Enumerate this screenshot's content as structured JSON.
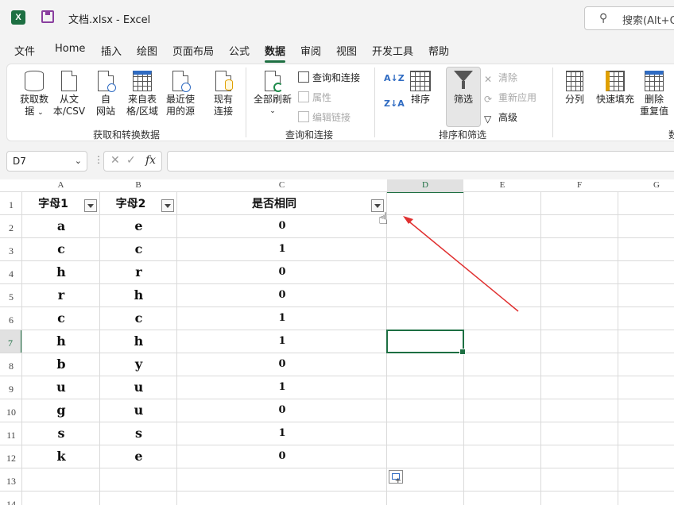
{
  "titlebar": {
    "app_icon_letter": "X",
    "document_title": "文档.xlsx  -  Excel",
    "search_placeholder": "搜索(Alt+Q)"
  },
  "menu": {
    "tabs": [
      "文件",
      "Home",
      "插入",
      "绘图",
      "页面布局",
      "公式",
      "数据",
      "审阅",
      "视图",
      "开发工具",
      "帮助"
    ],
    "active_tab": "数据"
  },
  "ribbon": {
    "get_transform": {
      "get_data_l1": "获取数",
      "get_data_l2": "据",
      "from_text_l1": "从文",
      "from_text_l2": "本/CSV",
      "from_web_l1": "自",
      "from_web_l2": "网站",
      "from_table_l1": "来自表",
      "from_table_l2": "格/区域",
      "recent_l1": "最近使",
      "recent_l2": "用的源",
      "existing_l1": "现有",
      "existing_l2": "连接",
      "group_label": "获取和转换数据"
    },
    "queries": {
      "refresh_all": "全部刷新",
      "queries_connections": "查询和连接",
      "properties": "属性",
      "edit_links": "编辑链接",
      "group_label": "查询和连接"
    },
    "sort_filter": {
      "sort_az": "A↓Z",
      "sort_za": "Z↓A",
      "sort": "排序",
      "filter": "筛选",
      "clear": "清除",
      "reapply": "重新应用",
      "advanced": "高级",
      "group_label": "排序和筛选"
    },
    "data_tools": {
      "text_to_columns": "分列",
      "flash_fill": "快速填充",
      "remove_dup_l1": "删除",
      "remove_dup_l2": "重复值",
      "group_label_partial": "数"
    }
  },
  "formula_bar": {
    "name_box": "D7",
    "fx": "fx",
    "formula": ""
  },
  "sheet": {
    "columns": [
      "A",
      "B",
      "C",
      "D",
      "E",
      "F",
      "G"
    ],
    "rows": [
      "1",
      "2",
      "3",
      "4",
      "5",
      "6",
      "7",
      "8",
      "9",
      "10",
      "11",
      "12",
      "13",
      "14"
    ],
    "selected_column": "D",
    "selected_row": "7",
    "headers": [
      "字母1",
      "字母2",
      "是否相同"
    ],
    "data": [
      [
        "a",
        "e",
        "0"
      ],
      [
        "c",
        "c",
        "1"
      ],
      [
        "h",
        "r",
        "0"
      ],
      [
        "r",
        "h",
        "0"
      ],
      [
        "c",
        "c",
        "1"
      ],
      [
        "h",
        "h",
        "1"
      ],
      [
        "b",
        "y",
        "0"
      ],
      [
        "u",
        "u",
        "1"
      ],
      [
        "g",
        "u",
        "0"
      ],
      [
        "s",
        "s",
        "1"
      ],
      [
        "k",
        "e",
        "0"
      ]
    ]
  },
  "colors": {
    "accent": "#1d6f42",
    "annotation_arrow": "#e03030"
  }
}
